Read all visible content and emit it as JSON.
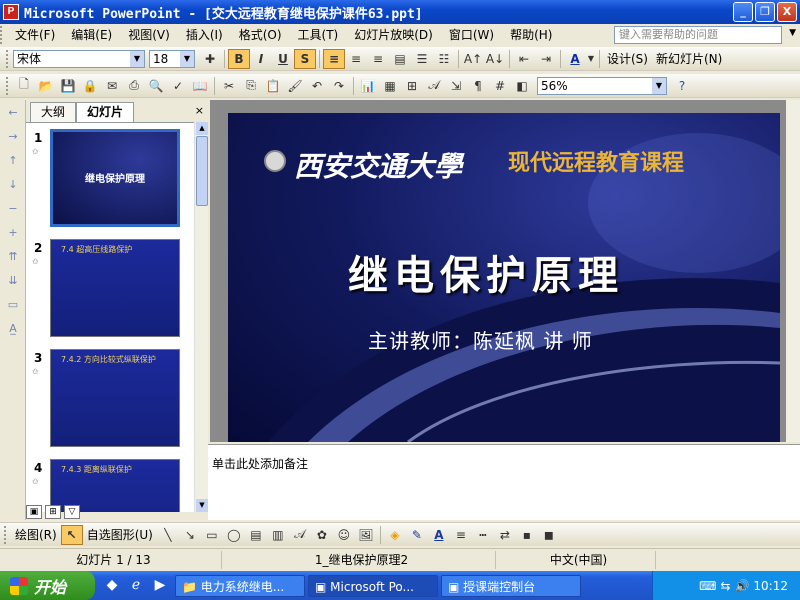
{
  "window": {
    "title": "Microsoft PowerPoint - [交大远程教育继电保护课件63.ppt]",
    "app_icon_letter": "P",
    "min_label": "_",
    "max_label": "❐",
    "close_label": "X"
  },
  "menubar": {
    "items": [
      "文件(F)",
      "编辑(E)",
      "视图(V)",
      "插入(I)",
      "格式(O)",
      "工具(T)",
      "幻灯片放映(D)",
      "窗口(W)",
      "帮助(H)"
    ],
    "help_placeholder": "键入需要帮助的问题"
  },
  "format_toolbar": {
    "font_name": "宋体",
    "font_size": "18",
    "bold": "B",
    "italic": "I",
    "underline": "U",
    "shadow": "S",
    "design_label": "设计(S)",
    "new_slide_label": "新幻灯片(N)"
  },
  "standard_toolbar": {
    "zoom": "56%"
  },
  "outline_panel": {
    "tab_outline": "大纲",
    "tab_slides": "幻灯片",
    "close": "×",
    "slides": [
      {
        "number": "1",
        "title": "继电保护原理"
      },
      {
        "number": "2",
        "title": "7.4 超高压线路保护"
      },
      {
        "number": "3",
        "title": "7.4.2 方向比较式纵联保护"
      },
      {
        "number": "4",
        "title": "7.4.3 距离纵联保护"
      }
    ]
  },
  "slide": {
    "university": "西安交通大學",
    "course": "现代远程教育课程",
    "title": "继电保护原理",
    "teacher": "主讲教师：陈延枫   讲 师"
  },
  "notes": {
    "placeholder": "单击此处添加备注"
  },
  "drawing_toolbar": {
    "draw_label": "绘图(R)",
    "autoshapes_label": "自选图形(U)"
  },
  "statusbar": {
    "slide_counter": "幻灯片 1 / 13",
    "design_name": "1_继电保护原理2",
    "language": "中文(中国)"
  },
  "taskbar": {
    "start_label": "开始",
    "tasks": [
      "电力系统继电...",
      "Microsoft Po...",
      "授课端控制台"
    ],
    "clock": "10:12"
  }
}
